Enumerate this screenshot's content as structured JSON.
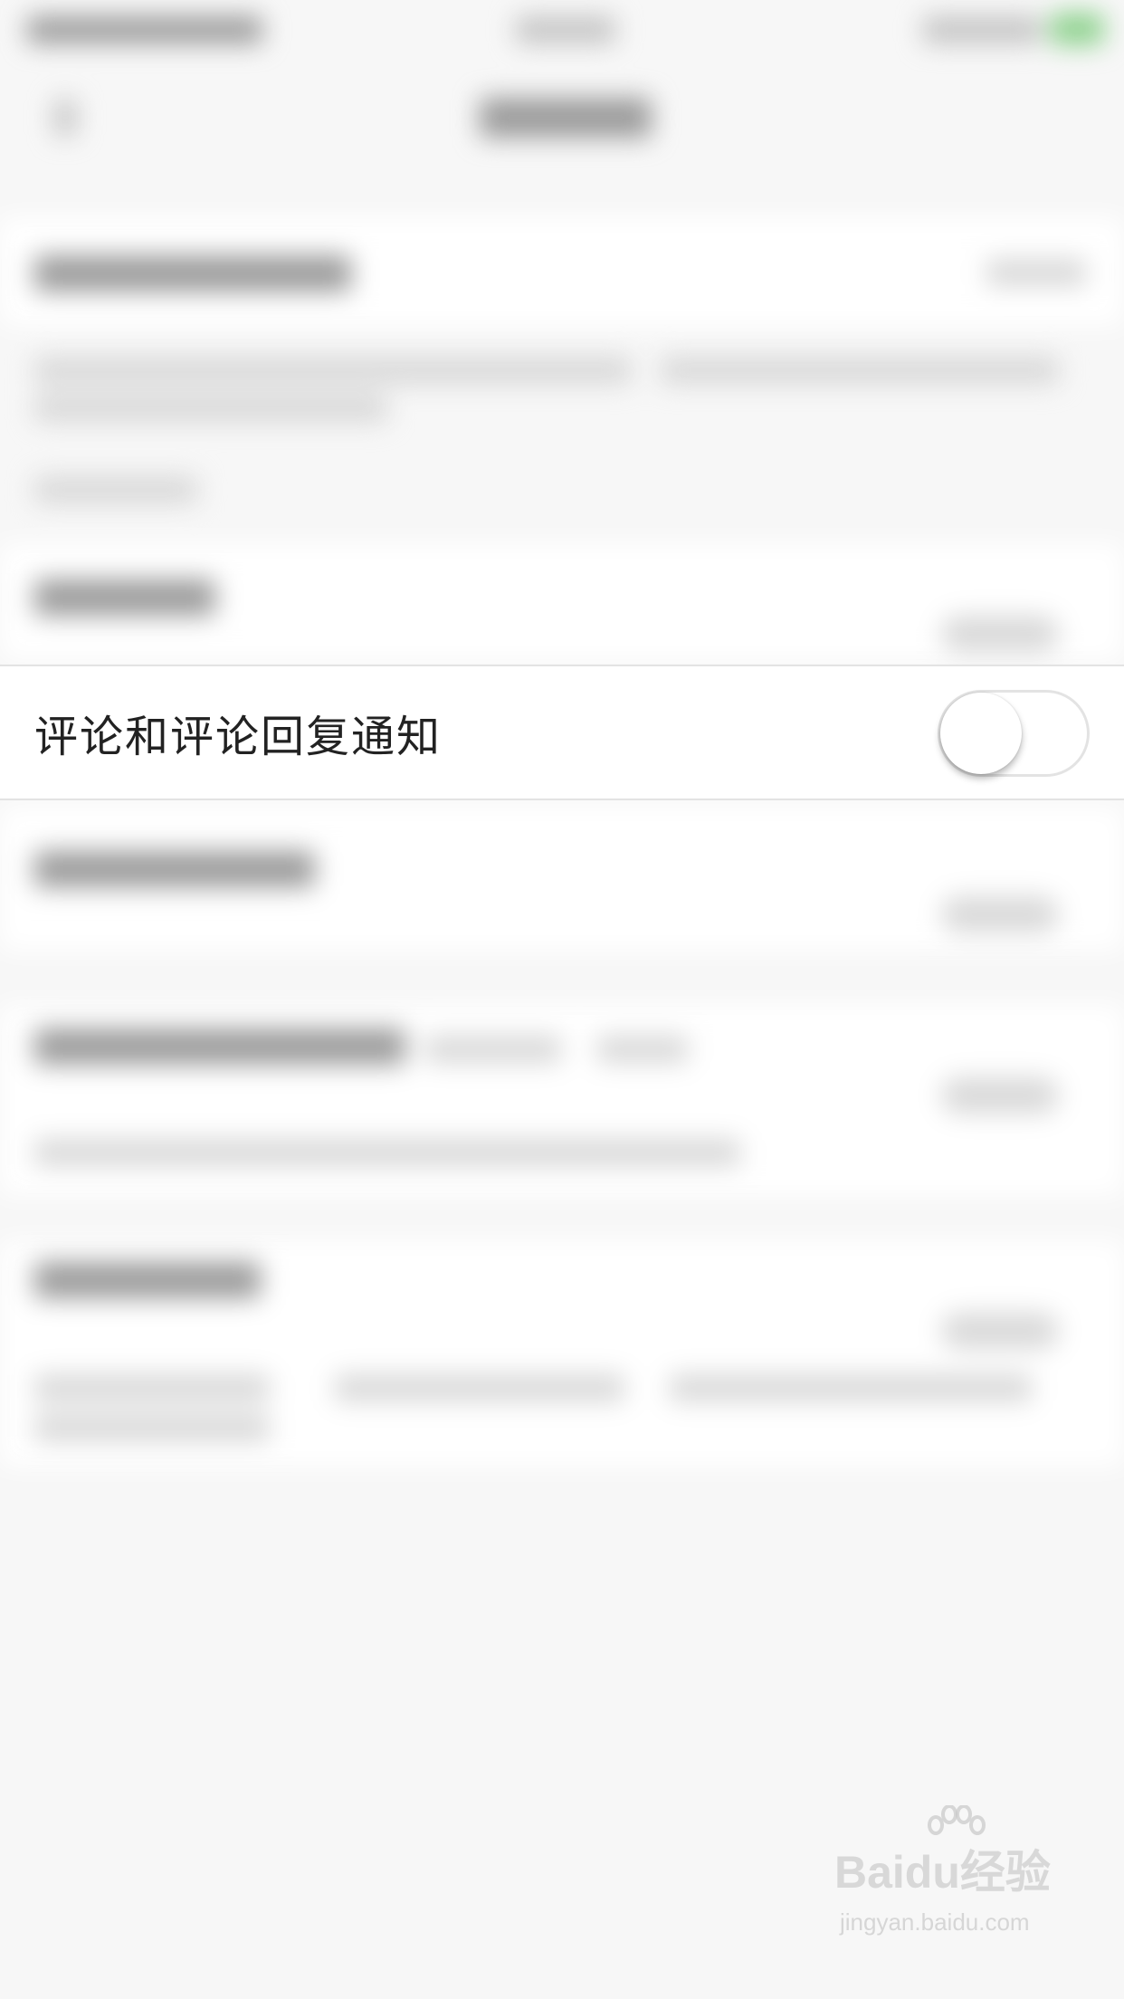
{
  "settings": {
    "comment_notification": {
      "label": "评论和评论回复通知",
      "enabled": false
    }
  },
  "watermark": {
    "logo": "Baidu经验",
    "url": "jingyan.baidu.com"
  }
}
